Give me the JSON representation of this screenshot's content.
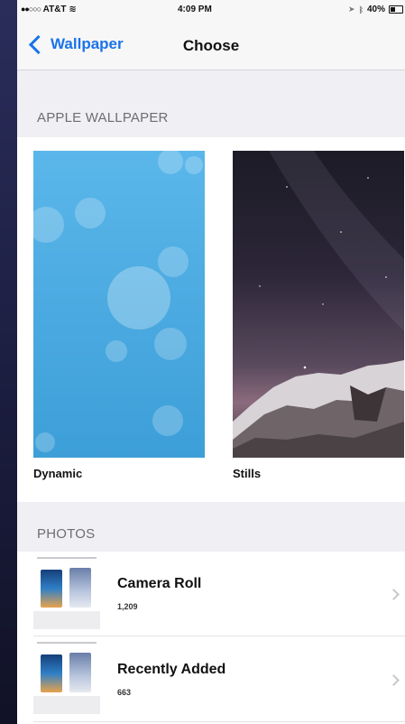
{
  "status_bar": {
    "carrier": "AT&T",
    "time": "4:09 PM",
    "battery": "40%"
  },
  "nav": {
    "back_label": "Wallpaper",
    "title": "Choose"
  },
  "apple_wallpaper": {
    "header": "APPLE WALLPAPER",
    "items": [
      {
        "label": "Dynamic"
      },
      {
        "label": "Stills"
      }
    ]
  },
  "photos": {
    "header": "PHOTOS",
    "albums": [
      {
        "title": "Camera Roll",
        "count": "1,209"
      },
      {
        "title": "Recently Added",
        "count": "663"
      }
    ]
  },
  "colors": {
    "accent": "#1a73e8",
    "background": "#efeff4"
  }
}
